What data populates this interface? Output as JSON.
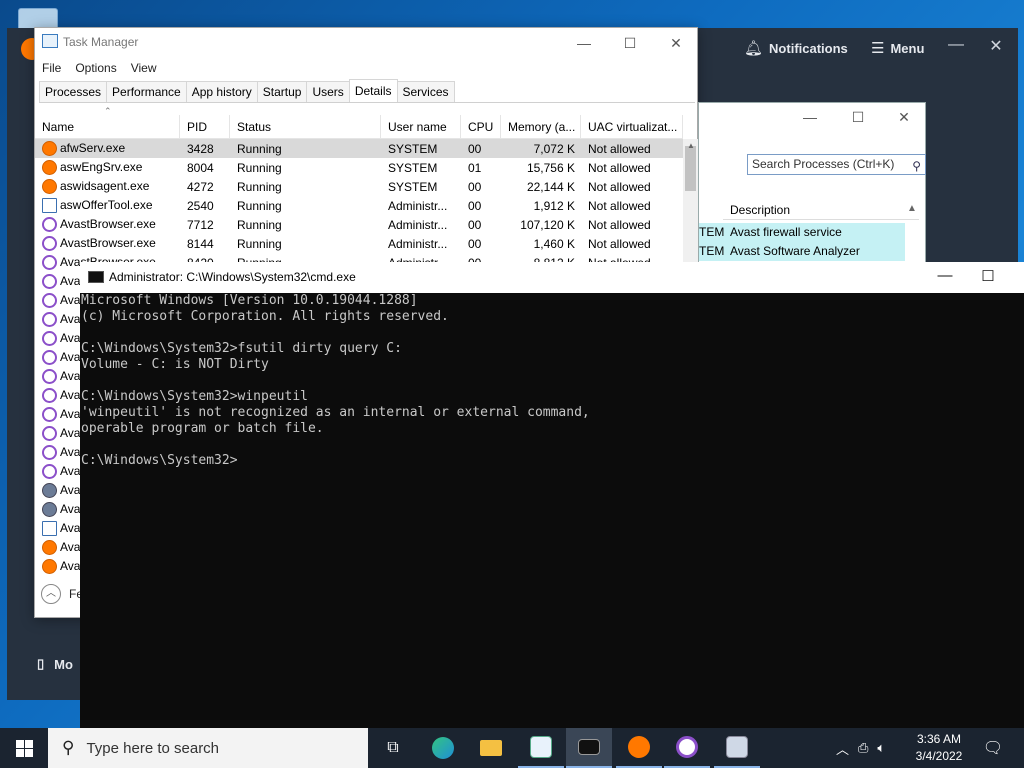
{
  "avast": {
    "notifications_label": "Notifications",
    "menu_label": "Menu",
    "mobile_label": "Mo"
  },
  "task_manager": {
    "title": "Task Manager",
    "menu": [
      "File",
      "Options",
      "View"
    ],
    "tabs": [
      "Processes",
      "Performance",
      "App history",
      "Startup",
      "Users",
      "Details",
      "Services"
    ],
    "active_tab": "Details",
    "columns": [
      "Name",
      "PID",
      "Status",
      "User name",
      "CPU",
      "Memory (a...",
      "UAC virtualizat..."
    ],
    "rows": [
      {
        "name": "afwServ.exe",
        "pid": "3428",
        "status": "Running",
        "user": "SYSTEM",
        "cpu": "00",
        "memory": "7,072 K",
        "uac": "Not allowed",
        "icon": "avast-orange-icon",
        "selected": true
      },
      {
        "name": "aswEngSrv.exe",
        "pid": "8004",
        "status": "Running",
        "user": "SYSTEM",
        "cpu": "01",
        "memory": "15,756 K",
        "uac": "Not allowed",
        "icon": "avast-orange-icon"
      },
      {
        "name": "aswidsagent.exe",
        "pid": "4272",
        "status": "Running",
        "user": "SYSTEM",
        "cpu": "00",
        "memory": "22,144 K",
        "uac": "Not allowed",
        "icon": "avast-orange-icon"
      },
      {
        "name": "aswOfferTool.exe",
        "pid": "2540",
        "status": "Running",
        "user": "Administr...",
        "cpu": "00",
        "memory": "1,912 K",
        "uac": "Not allowed",
        "icon": "window-icon"
      },
      {
        "name": "AvastBrowser.exe",
        "pid": "7712",
        "status": "Running",
        "user": "Administr...",
        "cpu": "00",
        "memory": "107,120 K",
        "uac": "Not allowed",
        "icon": "avast-browser-icon"
      },
      {
        "name": "AvastBrowser.exe",
        "pid": "8144",
        "status": "Running",
        "user": "Administr...",
        "cpu": "00",
        "memory": "1,460 K",
        "uac": "Not allowed",
        "icon": "avast-browser-icon"
      },
      {
        "name": "AvastBrowser.exe",
        "pid": "8420",
        "status": "Running",
        "user": "Administr...",
        "cpu": "00",
        "memory": "8,812 K",
        "uac": "Not allowed",
        "icon": "avast-browser-icon"
      }
    ],
    "hidden_row_stubs": [
      {
        "text": "Avas",
        "icon": "avast-browser-icon"
      },
      {
        "text": "Avas",
        "icon": "avast-browser-icon"
      },
      {
        "text": "Avas",
        "icon": "avast-browser-icon"
      },
      {
        "text": "Avas",
        "icon": "avast-browser-icon"
      },
      {
        "text": "Avas",
        "icon": "avast-browser-icon"
      },
      {
        "text": "Avas",
        "icon": "avast-browser-icon"
      },
      {
        "text": "Avas",
        "icon": "avast-browser-icon"
      },
      {
        "text": "Avas",
        "icon": "avast-browser-icon"
      },
      {
        "text": "Avas",
        "icon": "avast-browser-icon"
      },
      {
        "text": "Avas",
        "icon": "avast-browser-icon"
      },
      {
        "text": "Avas",
        "icon": "avast-browser-icon"
      },
      {
        "text": "Avas",
        "icon": "gear-icon"
      },
      {
        "text": "Avas",
        "icon": "gear-icon"
      },
      {
        "text": "Avas",
        "icon": "window-icon"
      },
      {
        "text": "Avas",
        "icon": "avast-orange-icon"
      },
      {
        "text": "Avas",
        "icon": "avast-orange-icon"
      }
    ],
    "fewer_details_label": "Fe"
  },
  "process_window": {
    "search_placeholder": "Search Processes (Ctrl+K)",
    "column": "Description",
    "rows": [
      {
        "a": "TEM",
        "b": "Avast firewall service"
      },
      {
        "a": "TEM",
        "b": "Avast Software Analyzer"
      }
    ]
  },
  "cmd": {
    "title": "Administrator: C:\\Windows\\System32\\cmd.exe",
    "lines": [
      "Microsoft Windows [Version 10.0.19044.1288]",
      "(c) Microsoft Corporation. All rights reserved.",
      "",
      "C:\\Windows\\System32>fsutil dirty query C:",
      "Volume - C: is NOT Dirty",
      "",
      "C:\\Windows\\System32>winpeutil",
      "'winpeutil' is not recognized as an internal or external command,",
      "operable program or batch file.",
      "",
      "C:\\Windows\\System32>"
    ]
  },
  "taskbar": {
    "search_placeholder": "Type here to search",
    "time": "3:36 AM",
    "date": "3/4/2022",
    "colors": {
      "avast_orange": "#ff7800",
      "avast_purple": "#8b4fc9",
      "taskbar": "#1b2430"
    }
  }
}
